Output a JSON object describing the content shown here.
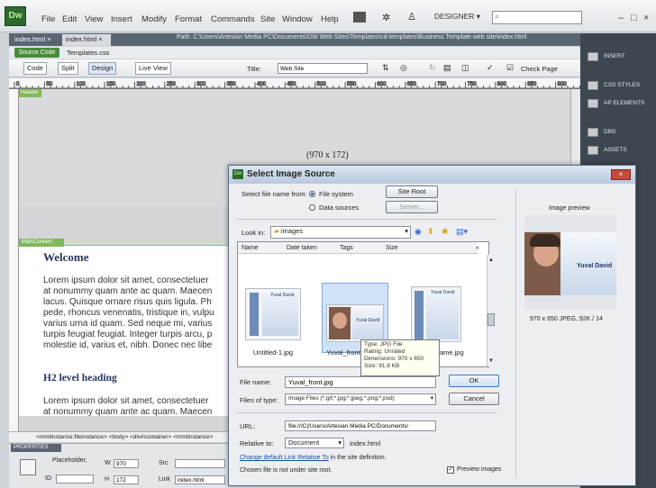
{
  "app": {
    "logo": "Dw",
    "menu": [
      "File",
      "Edit",
      "View",
      "Insert",
      "Modify",
      "Format",
      "Commands",
      "Site",
      "Window",
      "Help"
    ],
    "workspace": "DESIGNER",
    "search_placeholder": "",
    "win_controls": [
      "–",
      "□",
      "×"
    ]
  },
  "doc_tabs": [
    {
      "label": "index.html",
      "active": false,
      "close": "×"
    },
    {
      "label": "index.html",
      "active": true,
      "close": "×"
    }
  ],
  "path": "Path: C:\\Users\\Artesian Media PC\\Documents\\DW Web Sites\\Templates\\cd-templates\\Business Template web site\\index.html",
  "subbar": {
    "source_code": "Source Code",
    "related_file": "Templates.css"
  },
  "toolbar": {
    "code": "Code",
    "split": "Split",
    "design": "Design",
    "live_view": "Live View",
    "title_label": "Title:",
    "title_value": "Web Site",
    "check_page": "Check Page"
  },
  "ruler_ticks": [
    "0",
    "50",
    "100",
    "150",
    "200",
    "250",
    "300",
    "350",
    "400",
    "450",
    "500",
    "550",
    "600",
    "650",
    "700",
    "750",
    "800",
    "850",
    "900"
  ],
  "canvas": {
    "top_label": "Header",
    "dim_label": "(970 x 172)",
    "maincontent_label": "MainContent",
    "heading1": "Welcome",
    "para1": [
      "Lorem ipsum dolor sit amet, consectetuer",
      "at nonummy quam ante ac quam. Maecen",
      "lacus. Quisque ornare risus quis ligula. Ph",
      "pede, rhoncus venenatis, tristique in, vulpu",
      "varius urna id quam. Sed neque mi, varius",
      "turpis feugiat feugiat. Integer turpis arcu, p",
      "molestie id, varius et, nibh. Donec nec libe"
    ],
    "heading2": "H2 level heading",
    "para2": [
      "Lorem ipsum dolor sit amet, consectetuer",
      "at nonummy quam ante ac quam. Maecen"
    ]
  },
  "right_panel": [
    "INSERT",
    "CSS STYLES",
    "AP ELEMENTS",
    "DBS",
    "ASSETS"
  ],
  "status_bar": "<mmtinstance:fileinstance> <body> <div#container> <mmtinstance>",
  "properties": {
    "title": "PROPERTIES",
    "placeholder_label": "Placeholder,",
    "w_label": "W",
    "w_value": "970",
    "h_label": "H",
    "h_value": "172",
    "src_label": "Src",
    "link_label": "Link",
    "link_value": "index.html",
    "id_label": "ID"
  },
  "dialog": {
    "title": "Select Image Source",
    "select_from_label": "Select file name from:",
    "opt_filesystem": "File system",
    "opt_datasources": "Data sources",
    "site_root": "Site Root",
    "server": "Server...",
    "look_in_label": "Look in:",
    "look_in_value": "images",
    "columns": [
      "Name",
      "Date taken",
      "Tags",
      "Size"
    ],
    "col_more": "»",
    "files": [
      {
        "name": "Untitled-1.jpg",
        "selected": false,
        "thumb_text": "Yuval David"
      },
      {
        "name": "Yuval_front.jpg",
        "selected": true,
        "thumb_text": "Yuval David"
      },
      {
        "name": "frame.jpg",
        "selected": false,
        "thumb_text": "Yuval David"
      }
    ],
    "tooltip": [
      "Type: JPG File",
      "Rating: Unrated",
      "Dimensions: 970 x 650",
      "Size: 91.8 KB"
    ],
    "file_name_label": "File name:",
    "file_name_value": "Yuval_front.jpg",
    "files_of_type_label": "Files of type:",
    "files_of_type_value": "Image Files (*.gif;*.jpg;*.jpeg;*.png;*.psd)",
    "ok": "OK",
    "cancel": "Cancel",
    "url_label": "URL:",
    "url_value": "file:///C|/Users/Artesian Media PC/Documents/",
    "relative_to_label": "Relative to:",
    "relative_to_value": "Document",
    "relative_file": "index.html",
    "change_link": "Change default Link Relative To",
    "change_link_suffix": "in the site definition.",
    "not_under_root": "Chosen file is not under site root.",
    "preview_images": "Preview images",
    "preview_images_checked": true,
    "image_preview_label": "Image preview",
    "preview_name": "Yuval David",
    "preview_info": "970 x 650 JPEG, 92K / 14"
  }
}
